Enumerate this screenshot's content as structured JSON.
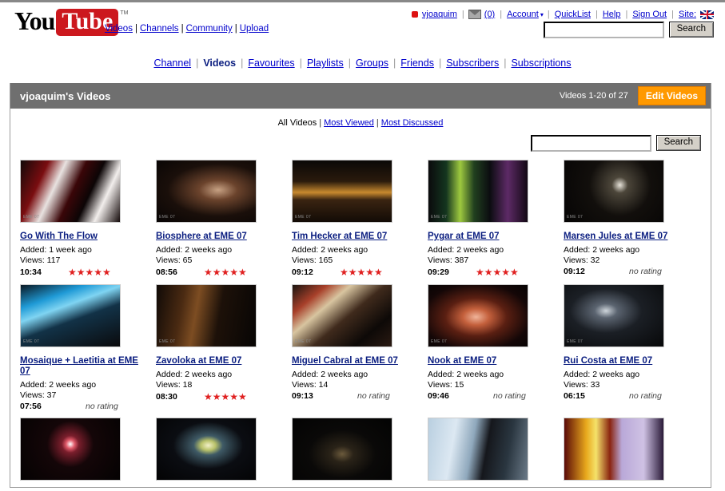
{
  "brand": {
    "you": "You",
    "tube": "Tube",
    "tm": "TM"
  },
  "main_nav": [
    {
      "label": "Videos"
    },
    {
      "label": "Channels"
    },
    {
      "label": "Community"
    },
    {
      "label": "Upload"
    }
  ],
  "account_nav": {
    "username": "vjoaquim",
    "inbox": "(0)",
    "account": "Account",
    "account_caret": "▾",
    "quicklist": "QuickList",
    "help": "Help",
    "signout": "Sign Out",
    "site_label": "Site:",
    "site_flag": "uk-flag-icon"
  },
  "top_search": {
    "value": "",
    "placeholder": "",
    "button": "Search"
  },
  "channel_tabs": [
    {
      "label": "Channel",
      "active": false
    },
    {
      "label": "Videos",
      "active": true
    },
    {
      "label": "Favourites",
      "active": false
    },
    {
      "label": "Playlists",
      "active": false
    },
    {
      "label": "Groups",
      "active": false
    },
    {
      "label": "Friends",
      "active": false
    },
    {
      "label": "Subscribers",
      "active": false
    },
    {
      "label": "Subscriptions",
      "active": false
    }
  ],
  "panel": {
    "title": "vjoaquim's Videos",
    "count": "Videos 1-20 of 27",
    "edit_button": "Edit Videos",
    "filters": [
      {
        "label": "All Videos",
        "active": true
      },
      {
        "label": "Most Viewed",
        "active": false
      },
      {
        "label": "Most Discussed",
        "active": false
      }
    ],
    "search": {
      "value": "",
      "placeholder": "",
      "button": "Search"
    }
  },
  "colors": {
    "brand_red": "#cc181e",
    "accent_orange": "#ff9900",
    "header_gray": "#6f6f6f",
    "link_blue": "#0b1e80",
    "star_red": "#e02020"
  },
  "videos": [
    {
      "title": "Go With The Flow",
      "added": "Added: 1 week ago",
      "views": "Views: 117",
      "duration": "10:34",
      "rating": 5,
      "rating_text": "★★★★★",
      "watermark": "EME 07",
      "thumb_style": "g1"
    },
    {
      "title": "Biosphere at EME 07",
      "added": "Added: 2 weeks ago",
      "views": "Views: 65",
      "duration": "08:56",
      "rating": 5,
      "rating_text": "★★★★★",
      "watermark": "EME 07",
      "thumb_style": "g2"
    },
    {
      "title": "Tim Hecker at EME 07",
      "added": "Added: 2 weeks ago",
      "views": "Views: 165",
      "duration": "09:12",
      "rating": 5,
      "rating_text": "★★★★★",
      "watermark": "EME 07",
      "thumb_style": "g3"
    },
    {
      "title": "Pygar at EME 07",
      "added": "Added: 2 weeks ago",
      "views": "Views: 387",
      "duration": "09:29",
      "rating": 5,
      "rating_text": "★★★★★",
      "watermark": "EME 07",
      "thumb_style": "g4"
    },
    {
      "title": "Marsen Jules at EME 07",
      "added": "Added: 2 weeks ago",
      "views": "Views: 32",
      "duration": "09:12",
      "rating": 0,
      "rating_text": "no rating",
      "watermark": "EME 07",
      "thumb_style": "g5"
    },
    {
      "title": "Mosaique + Laetitia at EME 07",
      "added": "Added: 2 weeks ago",
      "views": "Views: 37",
      "duration": "07:56",
      "rating": 0,
      "rating_text": "no rating",
      "watermark": "EME 07",
      "thumb_style": "g6"
    },
    {
      "title": "Zavoloka at EME 07",
      "added": "Added: 2 weeks ago",
      "views": "Views: 18",
      "duration": "08:30",
      "rating": 5,
      "rating_text": "★★★★★",
      "watermark": "EME 07",
      "thumb_style": "g7"
    },
    {
      "title": "Miguel Cabral at EME 07",
      "added": "Added: 2 weeks ago",
      "views": "Views: 14",
      "duration": "09:13",
      "rating": 0,
      "rating_text": "no rating",
      "watermark": "EME 07",
      "thumb_style": "g8"
    },
    {
      "title": "Nook at EME 07",
      "added": "Added: 2 weeks ago",
      "views": "Views: 15",
      "duration": "09:46",
      "rating": 0,
      "rating_text": "no rating",
      "watermark": "EME 07",
      "thumb_style": "g9"
    },
    {
      "title": "Rui Costa at EME 07",
      "added": "Added: 2 weeks ago",
      "views": "Views: 33",
      "duration": "06:15",
      "rating": 0,
      "rating_text": "no rating",
      "watermark": "EME 07",
      "thumb_style": "g10"
    },
    {
      "title": "",
      "added": "",
      "views": "",
      "duration": "",
      "rating": 0,
      "rating_text": "",
      "watermark": "",
      "thumb_style": "g11"
    },
    {
      "title": "",
      "added": "",
      "views": "",
      "duration": "",
      "rating": 0,
      "rating_text": "",
      "watermark": "",
      "thumb_style": "g12"
    },
    {
      "title": "",
      "added": "",
      "views": "",
      "duration": "",
      "rating": 0,
      "rating_text": "",
      "watermark": "",
      "thumb_style": "g13"
    },
    {
      "title": "",
      "added": "",
      "views": "",
      "duration": "",
      "rating": 0,
      "rating_text": "",
      "watermark": "",
      "thumb_style": "g14"
    },
    {
      "title": "",
      "added": "",
      "views": "",
      "duration": "",
      "rating": 0,
      "rating_text": "",
      "watermark": "",
      "thumb_style": "g15"
    }
  ]
}
